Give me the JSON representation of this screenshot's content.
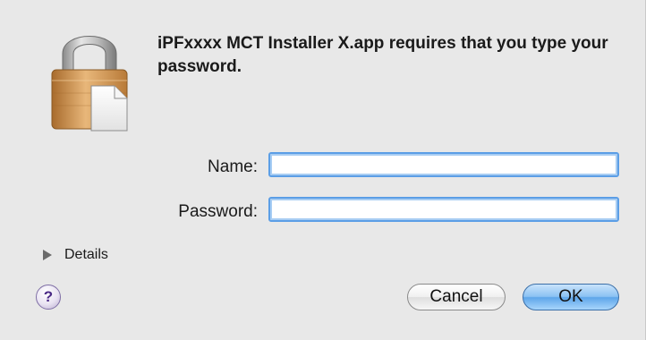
{
  "dialog": {
    "message": "iPFxxxx MCT Installer X.app requires that you type your password."
  },
  "form": {
    "name_label": "Name:",
    "name_value": "",
    "password_label": "Password:",
    "password_value": ""
  },
  "details": {
    "label": "Details"
  },
  "help": {
    "glyph": "?"
  },
  "buttons": {
    "cancel_label": "Cancel",
    "ok_label": "OK"
  },
  "icons": {
    "lock": "lock-icon",
    "document": "document-icon",
    "disclosure": "disclosure-triangle-icon",
    "help": "help-icon"
  }
}
